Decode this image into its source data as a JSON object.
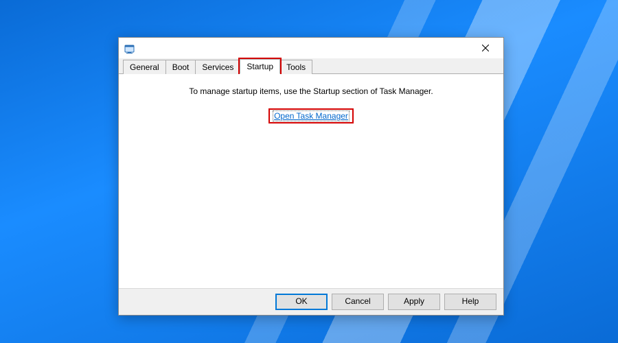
{
  "tabs": {
    "general": "General",
    "boot": "Boot",
    "services": "Services",
    "startup": "Startup",
    "tools": "Tools",
    "active": "startup"
  },
  "content": {
    "message": "To manage startup items, use the Startup section of Task Manager.",
    "link": "Open Task Manager"
  },
  "buttons": {
    "ok": "OK",
    "cancel": "Cancel",
    "apply": "Apply",
    "help": "Help"
  },
  "highlight": {
    "tab": "startup",
    "link": true,
    "color": "#d40000"
  }
}
